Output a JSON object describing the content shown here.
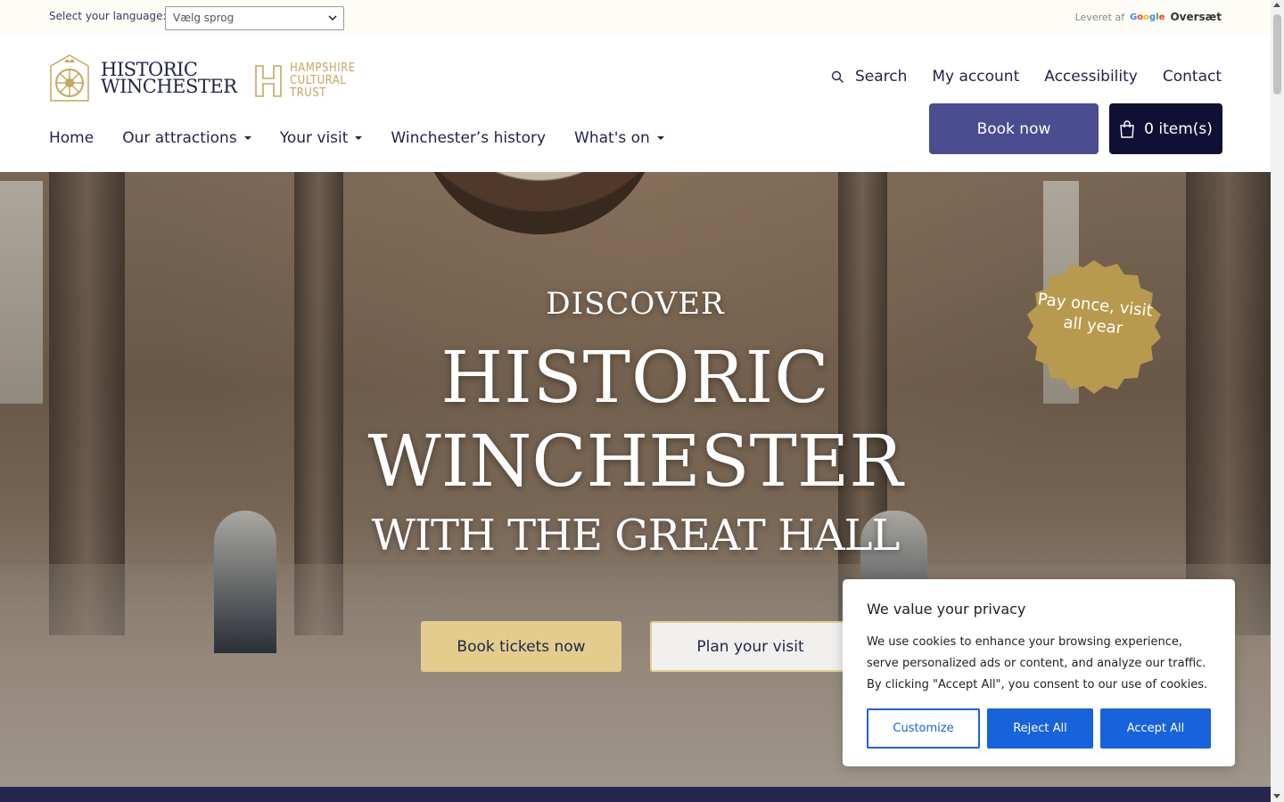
{
  "translate_bar": {
    "label": "Select your language:",
    "selected_language": "Vælg sprog",
    "powered_by": "Leveret af",
    "google": "Google",
    "translate": "Oversæt"
  },
  "header": {
    "logo_line1": "HISTORIC",
    "logo_line2": "WINCHESTER",
    "partner_line1": "HAMPSHIRE",
    "partner_line2": "CULTURAL",
    "partner_line3": "TRUST",
    "utility_nav": {
      "search": "Search",
      "account": "My account",
      "accessibility": "Accessibility",
      "contact": "Contact"
    },
    "main_nav": {
      "home": "Home",
      "attractions": "Our attractions",
      "visit": "Your visit",
      "history": "Winchester’s history",
      "whats_on": "What's on"
    },
    "book_now": "Book now",
    "basket": "0 item(s)"
  },
  "hero": {
    "discover": "DISCOVER",
    "title_line1": "HISTORIC",
    "title_line2": "WINCHESTER",
    "title_line3": "WITH THE GREAT HALL",
    "badge": "Pay once, visit all year",
    "book_tickets": "Book tickets now",
    "plan_visit": "Plan your visit"
  },
  "cookie": {
    "title": "We value your privacy",
    "body": "We use cookies to enhance your browsing experience, serve personalized ads or content, and analyze our traffic. By clicking \"Accept All\", you consent to our use of cookies.",
    "customize": "Customize",
    "reject": "Reject All",
    "accept": "Accept All"
  },
  "colors": {
    "navy": "#23254a",
    "book_button": "#4a4d8f",
    "basket_button": "#101035",
    "gold": "#c6a75b",
    "cookie_blue": "#1863dc"
  }
}
